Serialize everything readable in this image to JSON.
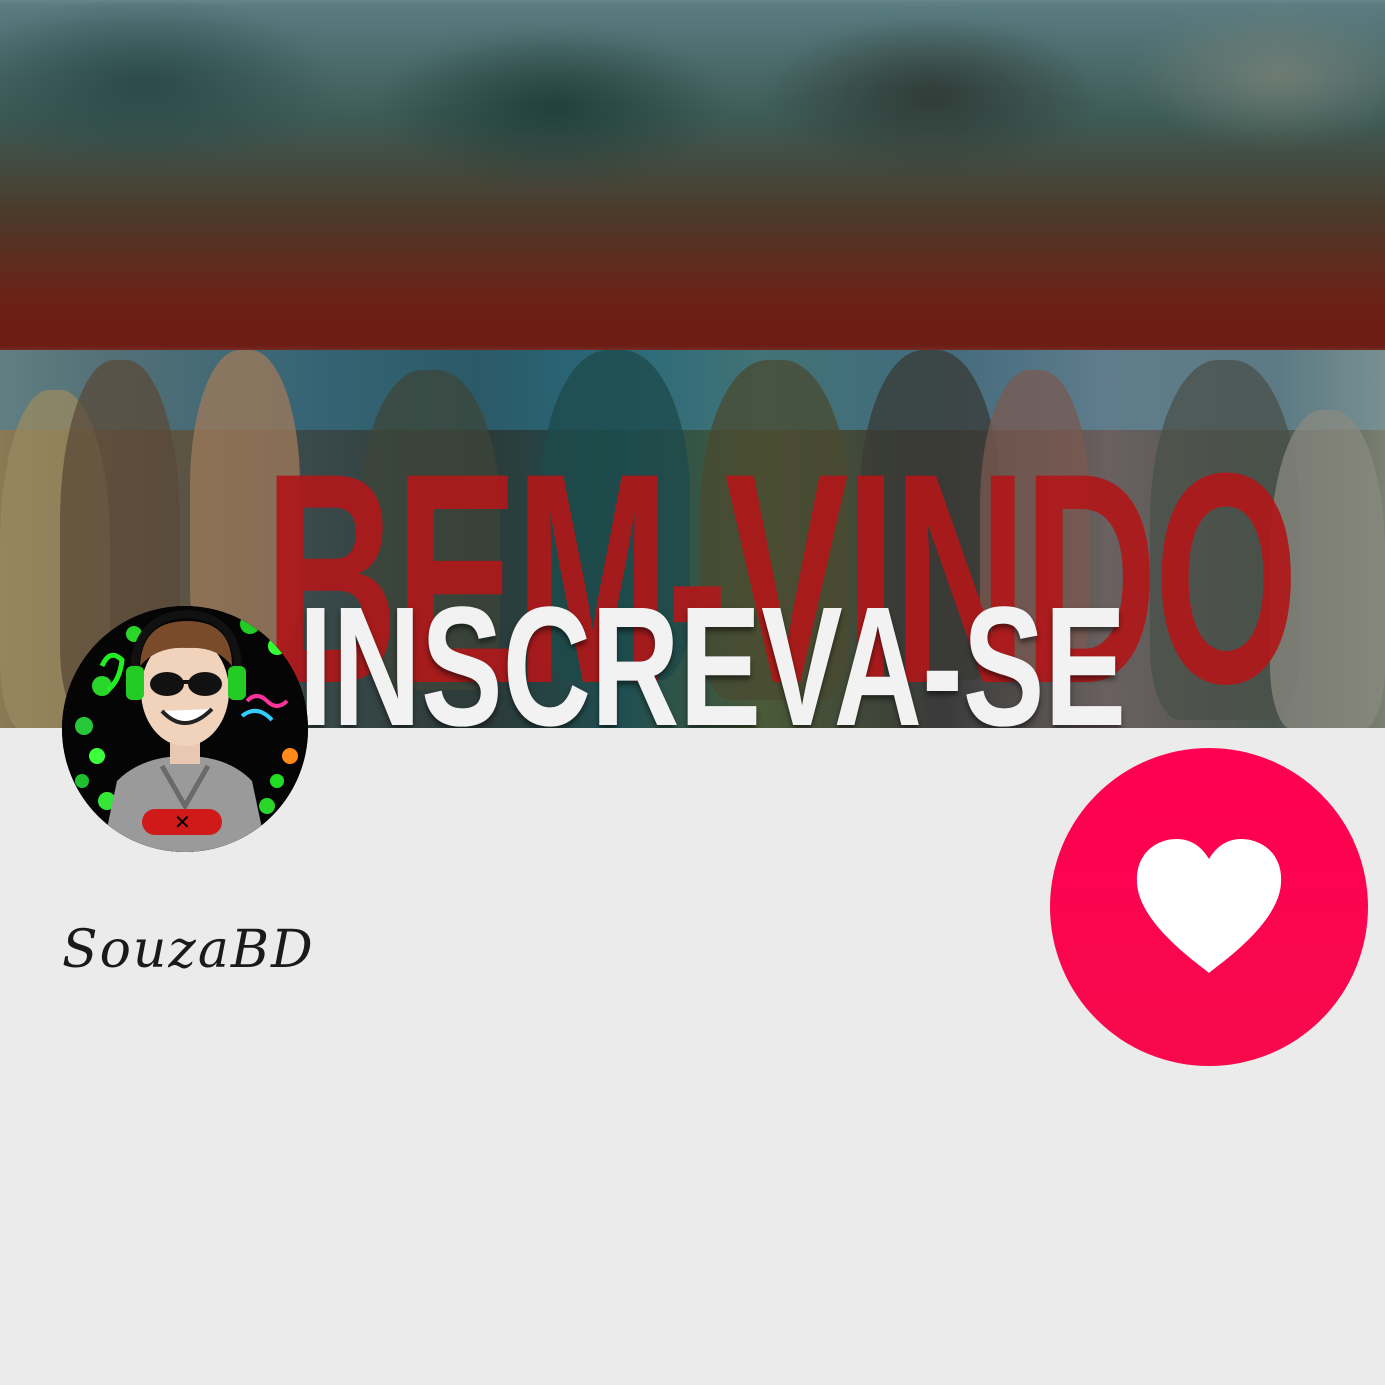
{
  "banner": {
    "headline": "BEM-VINDO",
    "subheadline": "INSCREVA-SE"
  },
  "profile": {
    "username": "SouzaBD",
    "avatar_icon": "cartoon-avatar-icon"
  },
  "actions": {
    "like_icon": "heart-icon"
  },
  "colors": {
    "background": "#ebebeb",
    "like_button": "#ff0052",
    "headline": "#b0181a",
    "subheadline": "#f2f2f2"
  }
}
